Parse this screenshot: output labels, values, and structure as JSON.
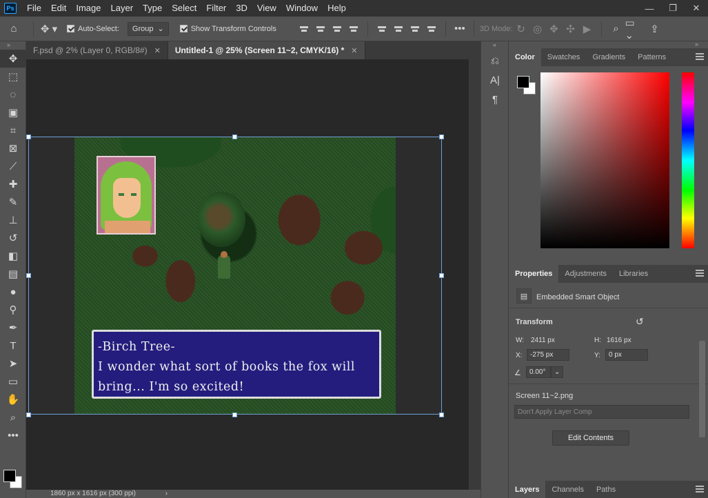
{
  "menu": {
    "app_icon": "Ps",
    "items": [
      "File",
      "Edit",
      "Image",
      "Layer",
      "Type",
      "Select",
      "Filter",
      "3D",
      "View",
      "Window",
      "Help"
    ],
    "window_controls": [
      "—",
      "❐",
      "✕"
    ]
  },
  "options": {
    "auto_select_label": "Auto-Select:",
    "auto_select_value": "Group",
    "transform_controls_label": "Show Transform Controls",
    "more": "•••",
    "mode_3d": "3D Mode:"
  },
  "tabs": [
    {
      "label": "F.psd @ 2% (Layer 0, RGB/8#)",
      "close": "✕",
      "active": false
    },
    {
      "label": "Untitled-1 @ 25% (Screen 11~2, CMYK/16) *",
      "close": "✕",
      "active": true
    }
  ],
  "status": {
    "text": "1860 px x 1616 px (300 ppi)",
    "arrow": "›"
  },
  "dialog": {
    "line1": "-Birch Tree-",
    "line2": "I wonder what sort of books the fox will",
    "line3": "bring... I'm so excited!"
  },
  "color_panel": {
    "tabs": [
      "Color",
      "Swatches",
      "Gradients",
      "Patterns"
    ],
    "foreground": "#000000",
    "background": "#ffffff"
  },
  "properties": {
    "tabs": [
      "Properties",
      "Adjustments",
      "Libraries"
    ],
    "object_type": "Embedded Smart Object",
    "transform_title": "Transform",
    "w_label": "W:",
    "w_value": "2411 px",
    "h_label": "H:",
    "h_value": "1616 px",
    "x_label": "X:",
    "x_value": "-275 px",
    "y_label": "Y:",
    "y_value": "0 px",
    "angle_value": "0.00°",
    "filename": "Screen 11~2.png",
    "layer_comp": "Don't Apply Layer Comp",
    "edit_button": "Edit Contents"
  },
  "layers_panel": {
    "tabs": [
      "Layers",
      "Channels",
      "Paths"
    ]
  }
}
